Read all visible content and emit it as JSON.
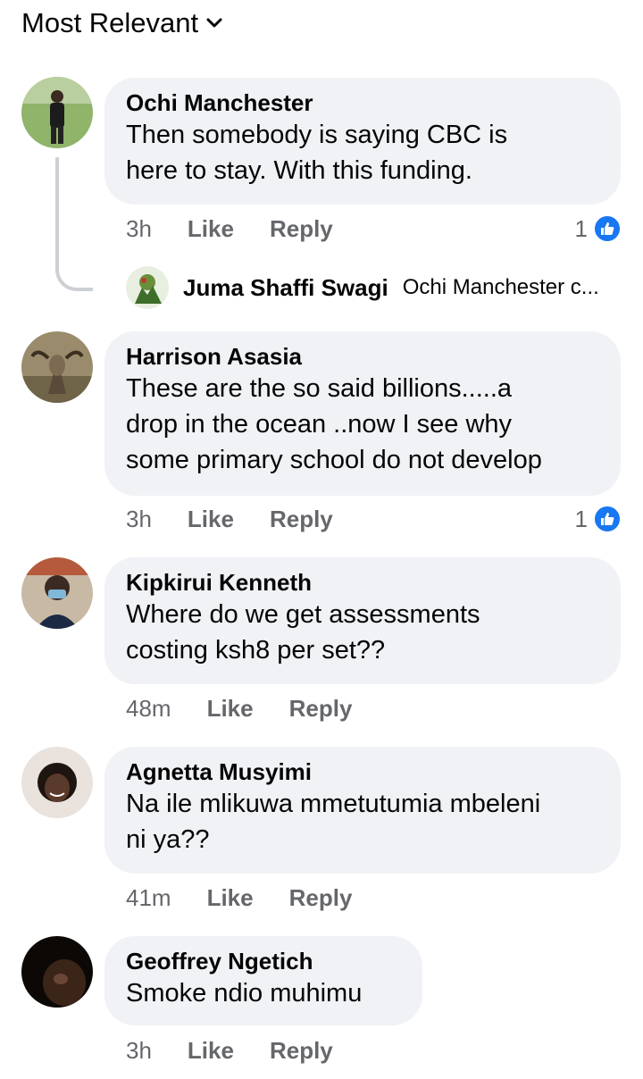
{
  "sort": {
    "label": "Most Relevant"
  },
  "comments": [
    {
      "author": "Ochi Manchester",
      "text": "Then somebody is saying CBC is\nhere to stay. With this funding.",
      "time": "3h",
      "like": "Like",
      "reply": "Reply",
      "reactions": "1"
    },
    {
      "author": "Harrison Asasia",
      "text": "These are the so said billions.....a\ndrop in the ocean ..now I see why\nsome primary school do not develop",
      "time": "3h",
      "like": "Like",
      "reply": "Reply",
      "reactions": "1"
    },
    {
      "author": "Kipkirui Kenneth",
      "text": "Where do we get assessments\ncosting ksh8 per set??",
      "time": "48m",
      "like": "Like",
      "reply": "Reply"
    },
    {
      "author": "Agnetta Musyimi",
      "text": "Na ile mlikuwa mmetutumia mbeleni\nni ya??",
      "time": "41m",
      "like": "Like",
      "reply": "Reply"
    },
    {
      "author": "Geoffrey Ngetich",
      "text": "Smoke ndio muhimu",
      "time": "3h",
      "like": "Like",
      "reply": "Reply"
    }
  ],
  "reply_preview": {
    "author": "Juma Shaffi Swagi",
    "text": "Ochi Manchester c..."
  },
  "colors": {
    "bubble": "#f0f2f5",
    "like_blue": "#1877f2",
    "meta_gray": "#65676b"
  }
}
